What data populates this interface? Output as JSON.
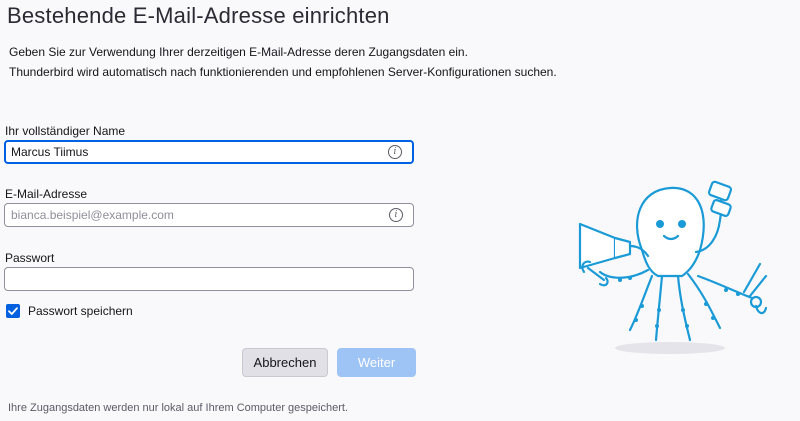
{
  "header": {
    "title": "Bestehende E-Mail-Adresse einrichten",
    "intro_line1": "Geben Sie zur Verwendung Ihrer derzeitigen E-Mail-Adresse deren Zugangsdaten ein.",
    "intro_line2": "Thunderbird wird automatisch nach funktionierenden und empfohlenen Server-Konfigurationen suchen."
  },
  "form": {
    "name": {
      "label": "Ihr vollständiger Name",
      "value": "Marcus Tiimus",
      "placeholder": ""
    },
    "email": {
      "label": "E-Mail-Adresse",
      "value": "",
      "placeholder": "bianca.beispiel@example.com"
    },
    "password": {
      "label": "Passwort",
      "value": "",
      "placeholder": ""
    },
    "remember_password": {
      "label": "Passwort speichern",
      "checked": true
    }
  },
  "buttons": {
    "cancel_label": "Abbrechen",
    "next_label": "Weiter"
  },
  "footer": {
    "note": "Ihre Zugangsdaten werden nur lokal auf Ihrem Computer gespeichert."
  },
  "icons": {
    "info": "info-icon",
    "check": "checkmark-icon",
    "mascot": "octopus-illustration"
  },
  "colors": {
    "accent": "#0061e0",
    "accent_disabled": "#9ec4f5",
    "mascot_outline": "#1a9ad6"
  }
}
